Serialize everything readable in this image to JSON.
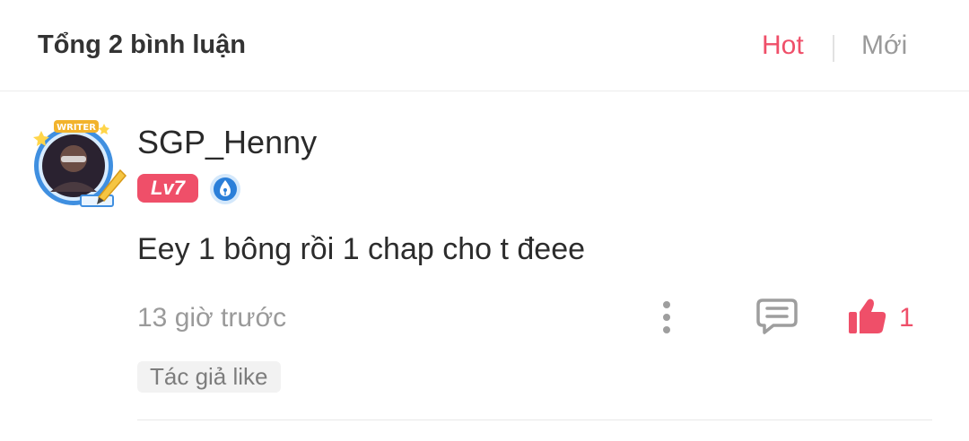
{
  "header": {
    "total_comments": "Tổng 2 bình luận",
    "sort_hot": "Hot",
    "sort_new": "Mới"
  },
  "comment": {
    "avatar_frame_label": "WRITER",
    "username": "SGP_Henny",
    "level": "Lv7",
    "text": "Eey 1 bông rồi 1 chap cho t đeee",
    "timestamp": "13 giờ trước",
    "like_count": "1",
    "author_liked_tag": "Tác giả like"
  },
  "colors": {
    "accent": "#ef4f69",
    "muted": "#9a9a9a",
    "writer_badge": "#2b7fd9"
  },
  "icons": {
    "more": "vertical-dots-icon",
    "reply": "comment-bubble-icon",
    "like": "thumbs-up-icon",
    "badge": "pen-nib-icon"
  }
}
